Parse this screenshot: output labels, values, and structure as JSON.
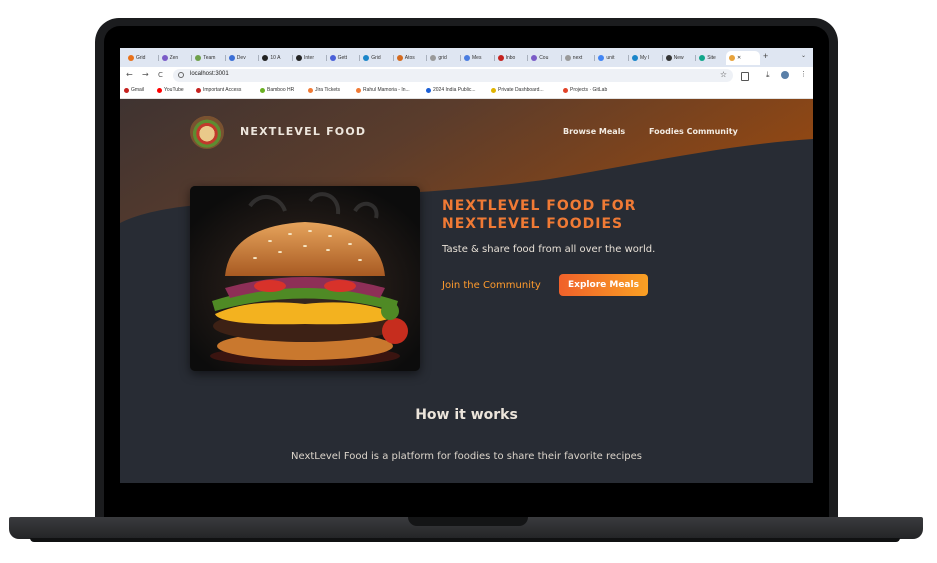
{
  "tabs": [
    {
      "label": "Grid",
      "color": "#e8711a"
    },
    {
      "label": "Zen",
      "color": "#7b5cc7"
    },
    {
      "label": "Team",
      "color": "#6ea04a"
    },
    {
      "label": "Dev",
      "color": "#3b6fd6"
    },
    {
      "label": "10 A",
      "color": "#222222"
    },
    {
      "label": "Inter",
      "color": "#222222"
    },
    {
      "label": "Gett",
      "color": "#4a60d8"
    },
    {
      "label": "Grid",
      "color": "#1b86c9"
    },
    {
      "label": "Atos",
      "color": "#d46a1e"
    },
    {
      "label": "grid",
      "color": "#9a9a9a"
    },
    {
      "label": "Mes",
      "color": "#4a7de0"
    },
    {
      "label": "Inbo",
      "color": "#c5221f"
    },
    {
      "label": "Cou",
      "color": "#7b5cc7"
    },
    {
      "label": "next",
      "color": "#9a9a9a"
    },
    {
      "label": "unit",
      "color": "#4285f4"
    },
    {
      "label": "My I",
      "color": "#1b86c9"
    },
    {
      "label": "New",
      "color": "#333333"
    },
    {
      "label": "Site",
      "color": "#11a68a"
    }
  ],
  "active_tab": {
    "close": "✕"
  },
  "new_tab": "+",
  "tab_menu": "⌄",
  "toolbar": {
    "back": "←",
    "forward": "→",
    "reload": "C",
    "url": "localhost:3001",
    "star": "☆",
    "menu": "⋮"
  },
  "bookmarks": [
    {
      "label": "Gmail",
      "color": "#c5221f"
    },
    {
      "label": "YouTube",
      "color": "#ff0000"
    },
    {
      "label": "Important Access",
      "color": "#c5221f"
    },
    {
      "label": "Bamboo HR",
      "color": "#6ab023"
    },
    {
      "label": "Jira Tickets",
      "color": "#f07a35"
    },
    {
      "label": "Rahul Mamoria - In...",
      "color": "#f07a35"
    },
    {
      "label": "2024 India Public...",
      "color": "#1b5fd6"
    },
    {
      "label": "Private Dashboard...",
      "color": "#e0b400"
    },
    {
      "label": "Projects · GitLab",
      "color": "#e24329"
    }
  ],
  "site": {
    "brand": "NEXTLEVEL FOOD",
    "nav": [
      "Browse Meals",
      "Foodies Community"
    ],
    "hero_title": "NEXTLEVEL FOOD FOR NEXTLEVEL FOODIES",
    "hero_sub": "Taste & share food from all over the world.",
    "cta_link": "Join the Community",
    "cta_button": "Explore Meals",
    "how_title": "How it works",
    "how_text": "NextLevel Food is a platform for foodies to share their favorite recipes"
  },
  "colors": {
    "accent": "#f07a35",
    "page_bg": "#282c34",
    "header_brown": "#8a4a1c"
  }
}
